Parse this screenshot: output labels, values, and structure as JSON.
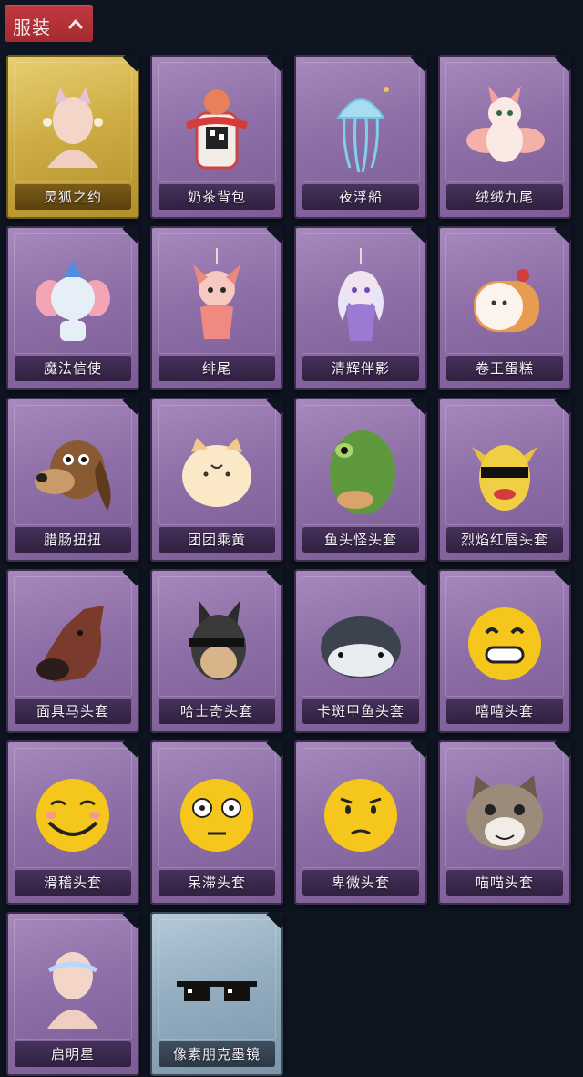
{
  "section": {
    "title": "服装"
  },
  "colors": {
    "header": "#b1323a",
    "background": "#0e1420",
    "purple": "#8e6fa7",
    "gold": "#cfae45",
    "blue": "#94adc0"
  },
  "items": [
    {
      "name": "灵狐之约",
      "rarity": "gold",
      "icon": "fox-spirit-avatar-icon"
    },
    {
      "name": "奶茶背包",
      "rarity": "purple",
      "icon": "milk-tea-backpack-icon"
    },
    {
      "name": "夜浮船",
      "rarity": "purple",
      "icon": "jellyfish-icon"
    },
    {
      "name": "绒绒九尾",
      "rarity": "purple",
      "icon": "nine-tailed-fox-icon"
    },
    {
      "name": "魔法信使",
      "rarity": "purple",
      "icon": "elephant-icon"
    },
    {
      "name": "绯尾",
      "rarity": "purple",
      "icon": "fox-girl-charm-icon"
    },
    {
      "name": "清辉伴影",
      "rarity": "purple",
      "icon": "moon-girl-charm-icon"
    },
    {
      "name": "卷王蛋糕",
      "rarity": "purple",
      "icon": "roll-cake-icon"
    },
    {
      "name": "腊肠扭扭",
      "rarity": "purple",
      "icon": "dachshund-head-icon"
    },
    {
      "name": "团团乘黄",
      "rarity": "purple",
      "icon": "cat-bun-head-icon"
    },
    {
      "name": "鱼头怪头套",
      "rarity": "purple",
      "icon": "fish-head-mask-icon"
    },
    {
      "name": "烈焰红唇头套",
      "rarity": "purple",
      "icon": "yellow-mask-icon"
    },
    {
      "name": "面具马头套",
      "rarity": "purple",
      "icon": "horse-head-mask-icon"
    },
    {
      "name": "哈士奇头套",
      "rarity": "purple",
      "icon": "husky-head-mask-icon"
    },
    {
      "name": "卡斑甲鱼头套",
      "rarity": "purple",
      "icon": "fish-helmet-icon"
    },
    {
      "name": "嘻嘻头套",
      "rarity": "purple",
      "icon": "grin-emoji-icon"
    },
    {
      "name": "滑稽头套",
      "rarity": "purple",
      "icon": "funny-emoji-icon"
    },
    {
      "name": "呆滞头套",
      "rarity": "purple",
      "icon": "blank-stare-emoji-icon"
    },
    {
      "name": "卑微头套",
      "rarity": "purple",
      "icon": "timid-emoji-icon"
    },
    {
      "name": "喵喵头套",
      "rarity": "purple",
      "icon": "cat-face-mask-icon"
    },
    {
      "name": "启明星",
      "rarity": "purple",
      "icon": "morning-star-avatar-icon"
    },
    {
      "name": "像素朋克墨镜",
      "rarity": "blue",
      "icon": "pixel-sunglasses-icon"
    }
  ]
}
